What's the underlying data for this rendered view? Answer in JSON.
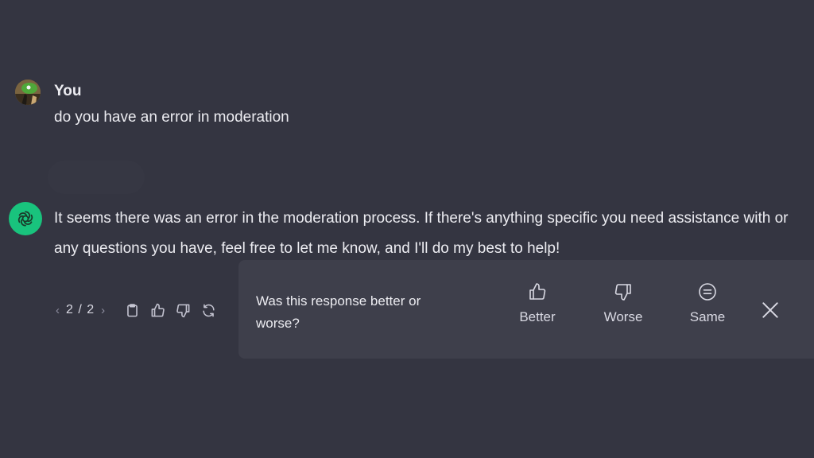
{
  "user_message": {
    "author": "You",
    "text": "do you have an error in moderation",
    "avatar_icon": "user-avatar-image"
  },
  "assistant_message": {
    "avatar_icon": "openai-logo-icon",
    "avatar_color": "#19c37d",
    "text": "It seems there was an error in the moderation process. If there's anything specific you need assistance with or any questions you have, feel free to let me know, and I'll do my best to help!"
  },
  "actions": {
    "prev_icon": "‹",
    "next_icon": "›",
    "pager": "2 / 2",
    "copy_icon": "clipboard-icon",
    "like_icon": "thumbs-up-icon",
    "dislike_icon": "thumbs-down-icon",
    "regenerate_icon": "refresh-icon"
  },
  "feedback": {
    "question": "Was this response better or worse?",
    "options": [
      {
        "label": "Better",
        "icon": "thumbs-up-icon"
      },
      {
        "label": "Worse",
        "icon": "thumbs-down-icon"
      },
      {
        "label": "Same",
        "icon": "equal-circle-icon"
      }
    ],
    "close_icon": "close-icon"
  },
  "colors": {
    "background": "#343541",
    "panel": "#3e3f4b",
    "text": "#ececf1",
    "accent": "#19c37d"
  }
}
